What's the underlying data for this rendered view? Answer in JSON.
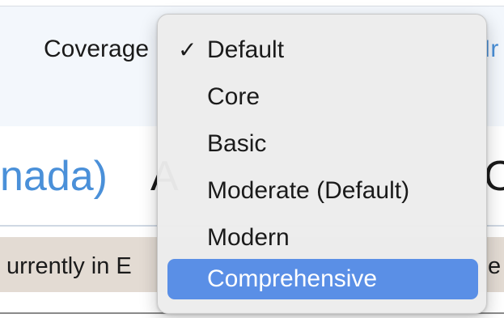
{
  "toolbar": {
    "coverage_label": "Coverage",
    "link_fragment": "Ir"
  },
  "heading": {
    "fragment_blue": "nada)",
    "fragment_dark": "A",
    "fragment_right": "O"
  },
  "banner": {
    "text_left": "urrently in E",
    "text_right": "e w"
  },
  "coverage_menu": {
    "checked_index": 0,
    "highlighted_index": 5,
    "check_glyph": "✓",
    "items": [
      {
        "label": "Default"
      },
      {
        "label": "Core"
      },
      {
        "label": "Basic"
      },
      {
        "label": "Moderate (Default)"
      },
      {
        "label": "Modern"
      },
      {
        "label": "Comprehensive"
      }
    ]
  },
  "colors": {
    "highlight": "#5a8fe6",
    "link": "#4a90d9",
    "banner_bg": "#e3dbd3",
    "toolbar_bg": "#f3f7fc"
  }
}
